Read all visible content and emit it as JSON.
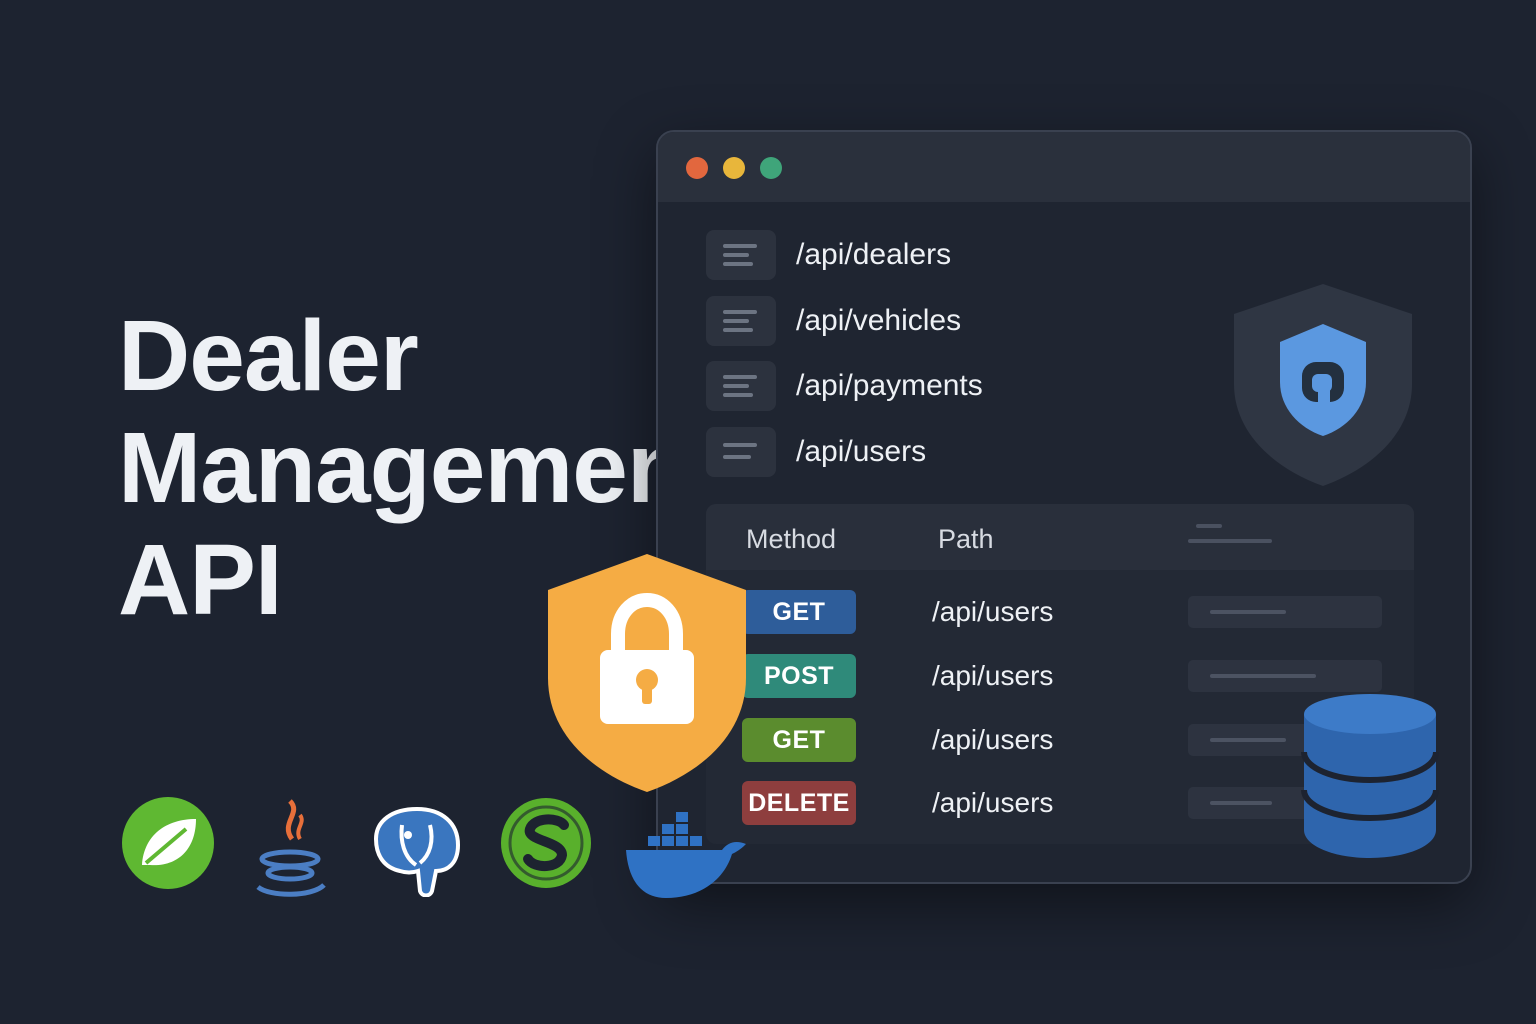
{
  "hero": {
    "title_lines": [
      "Dealer",
      "Managemen",
      "API"
    ]
  },
  "window": {
    "controls": [
      "close",
      "minimize",
      "maximize"
    ],
    "endpoints": [
      "/api/dealers",
      "/api/vehicles",
      "/api/payments",
      "/api/users"
    ],
    "table": {
      "headers": {
        "method": "Method",
        "path": "Path"
      },
      "rows": [
        {
          "method": "GET",
          "path": "/api/users",
          "color": "#2e5d9a"
        },
        {
          "method": "POST",
          "path": "/api/users",
          "color": "#2f8a7a"
        },
        {
          "method": "GET",
          "path": "/api/users",
          "color": "#5b8c2e"
        },
        {
          "method": "DELETE",
          "path": "/api/users",
          "color": "#8e3e3e"
        }
      ]
    }
  },
  "icons": {
    "security": "shield-icon",
    "lock": "lock-shield-icon",
    "database": "database-icon"
  },
  "tech_stack": [
    "spring-icon",
    "java-icon",
    "postgresql-icon",
    "swagger-icon",
    "docker-icon"
  ],
  "colors": {
    "background": "#1d2330",
    "lock_shield": "#f5ac44",
    "database": "#2e65ad",
    "security_shield": "#5b98e0"
  }
}
